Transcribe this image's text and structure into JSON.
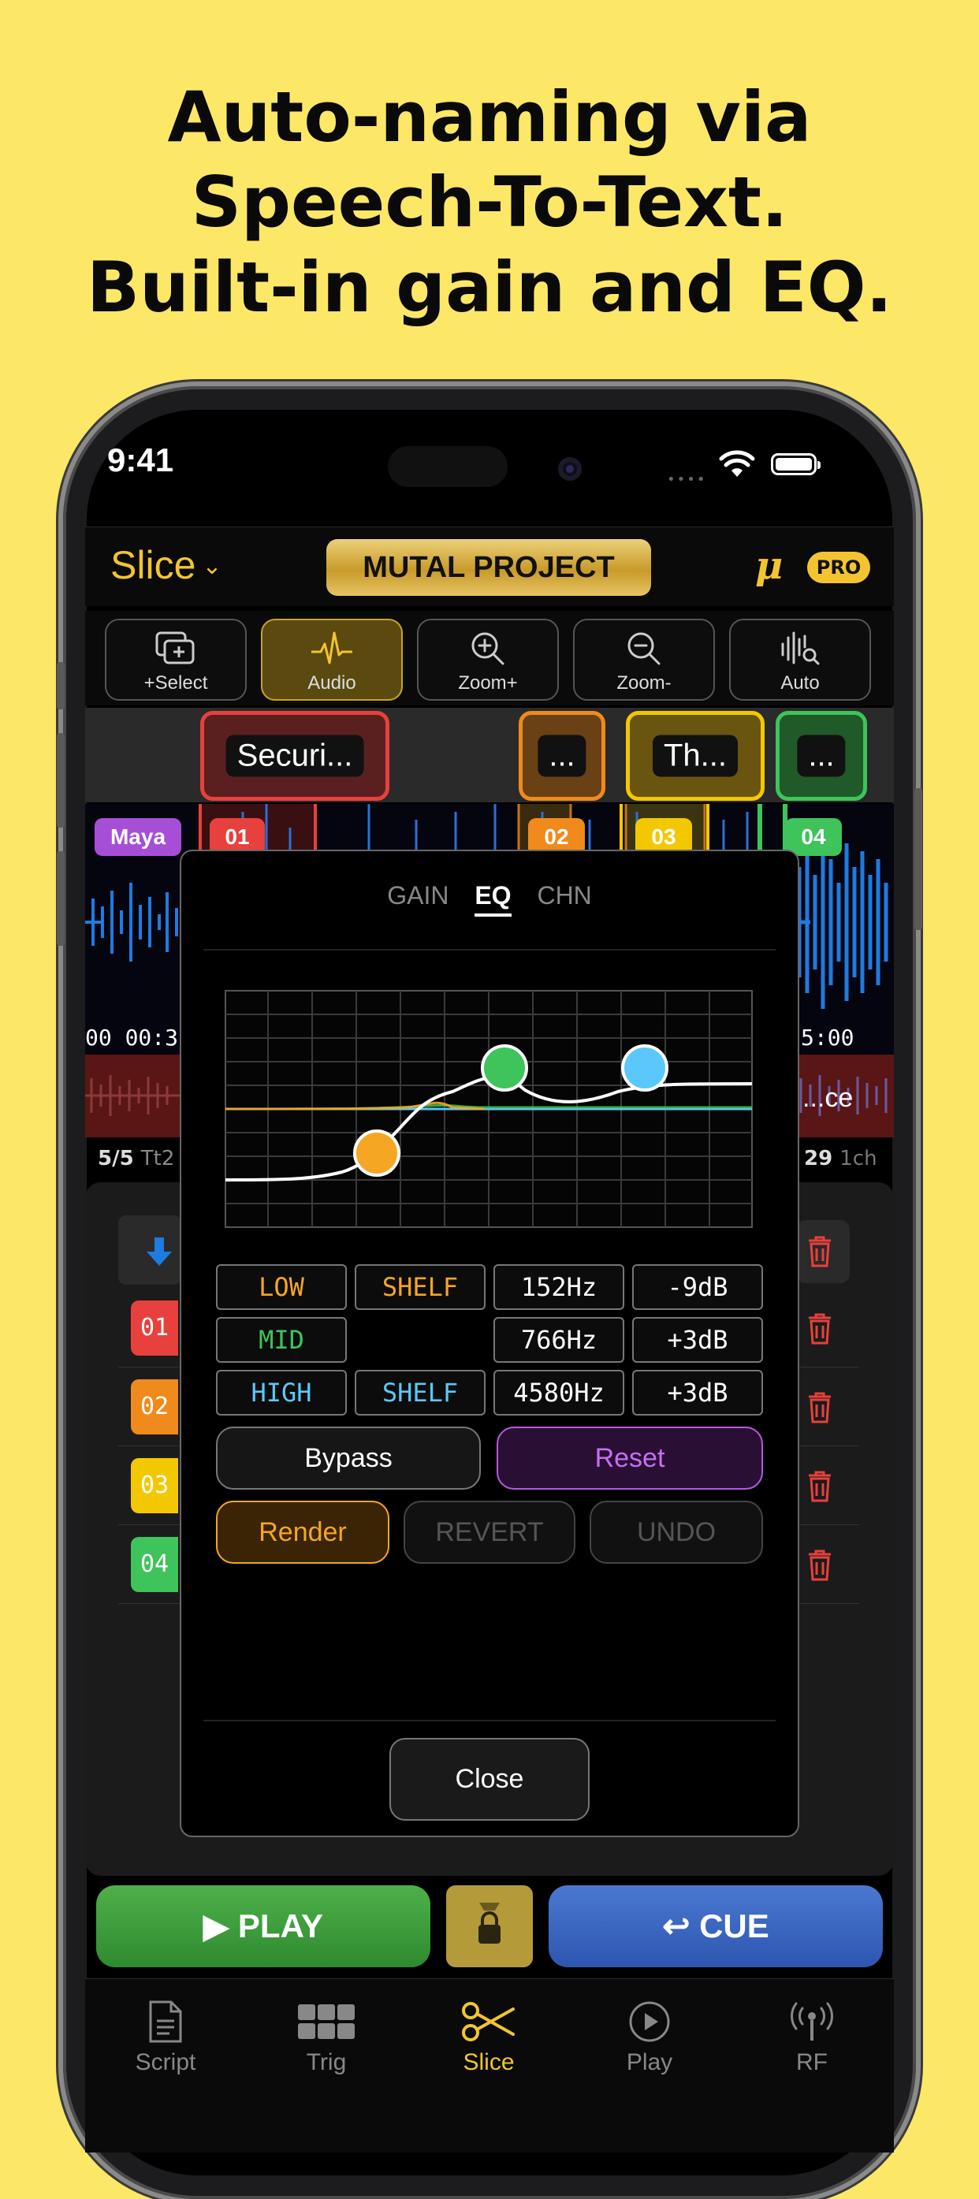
{
  "headline": [
    "Auto-naming via",
    "Speech-To-Text.",
    "Built-in gain and EQ."
  ],
  "status": {
    "time": "9:41"
  },
  "app": {
    "title": "Slice",
    "project": "MUTAL PROJECT",
    "mu": "μ",
    "pro": "PRO"
  },
  "toolbar": {
    "select": "+Select",
    "audio": "Audio",
    "zoom_in": "Zoom+",
    "zoom_out": "Zoom-",
    "auto": "Auto"
  },
  "clips": [
    {
      "text": "Securi...",
      "color": "#E8403C"
    },
    {
      "text": "...",
      "color": "#F08A1C"
    },
    {
      "text": "Th...",
      "color": "#F4C800"
    },
    {
      "text": "...",
      "color": "#3EC45A"
    }
  ],
  "markers": {
    "speaker": "Maya",
    "m1": "01",
    "m2": "02",
    "m3": "03",
    "m4": "04"
  },
  "timeline": {
    "left": "00 00:3",
    "right": "5:00"
  },
  "info": {
    "count": "5/5",
    "take": "Tt2",
    "num": "29",
    "channels": "1ch"
  },
  "rows": [
    "01",
    "02",
    "03",
    "04"
  ],
  "tabs": {
    "gain": "GAIN",
    "eq": "EQ",
    "chn": "CHN"
  },
  "eq_bands": [
    {
      "band": "LOW",
      "type": "SHELF",
      "freq": "152Hz",
      "gain": "-9dB",
      "color": "#F5A623"
    },
    {
      "band": "MID",
      "type": "",
      "freq": "766Hz",
      "gain": "+3dB",
      "color": "#3EC45A"
    },
    {
      "band": "HIGH",
      "type": "SHELF",
      "freq": "4580Hz",
      "gain": "+3dB",
      "color": "#5AC8FA"
    }
  ],
  "buttons": {
    "bypass": "Bypass",
    "reset": "Reset",
    "render": "Render",
    "revert": "REVERT",
    "undo": "UNDO",
    "close": "Close"
  },
  "transport": {
    "play": "PLAY",
    "cue": "CUE"
  },
  "bottom_tabs": {
    "script": "Script",
    "trig": "Trig",
    "slice": "Slice",
    "play": "Play",
    "rf": "RF"
  }
}
